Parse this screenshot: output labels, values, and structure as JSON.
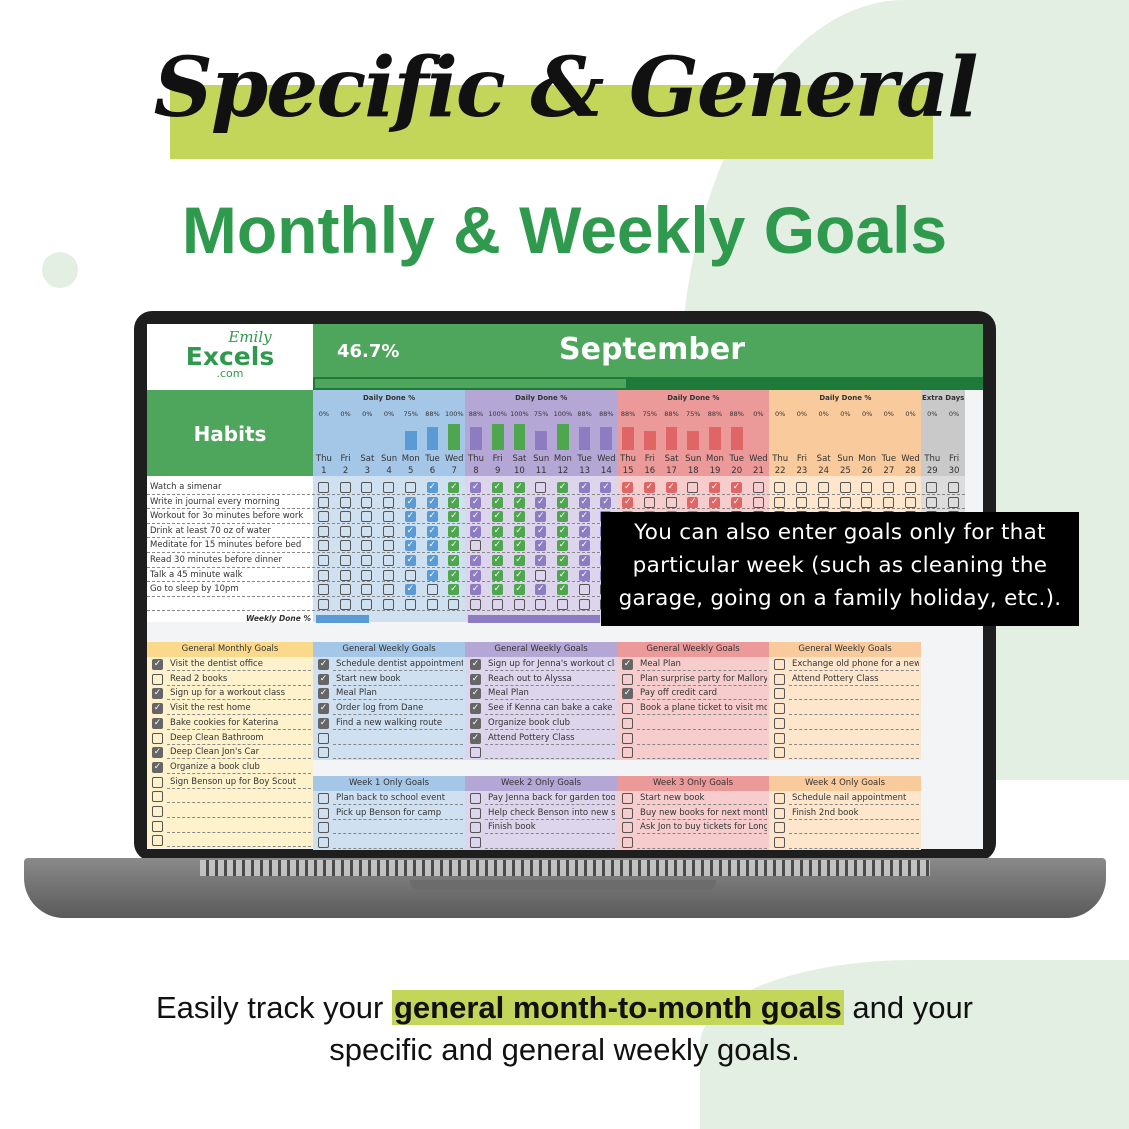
{
  "title_script": "Specific & General",
  "title_main": "Monthly & Weekly Goals",
  "colors": {
    "accent_green": "#2f9a4e",
    "lime": "#c3d65a",
    "week1": "#5b9bd5",
    "week2": "#8e7cc3",
    "week3": "#e06666",
    "week4": "#f9cb9c",
    "extra": "#bdbdbd",
    "done_full": "#4ea64f"
  },
  "logo": {
    "line1": "Emily",
    "line2": "Excels",
    "line3": ".com"
  },
  "sheet": {
    "month_percent": "46.7%",
    "month_progress": 0.467,
    "month": "September",
    "habits_label": "Habits",
    "weekly_done_label": "Weekly Done %",
    "week_headers": [
      "Daily Done %",
      "Daily Done %",
      "Daily Done %",
      "Daily Done %",
      "Extra Days"
    ],
    "weekly_done": [
      0.36,
      0.9,
      0,
      0,
      0
    ],
    "days": [
      {
        "d": "Thu",
        "n": "1",
        "p": "0%"
      },
      {
        "d": "Fri",
        "n": "2",
        "p": "0%"
      },
      {
        "d": "Sat",
        "n": "3",
        "p": "0%"
      },
      {
        "d": "Sun",
        "n": "4",
        "p": "0%"
      },
      {
        "d": "Mon",
        "n": "5",
        "p": "75%"
      },
      {
        "d": "Tue",
        "n": "6",
        "p": "88%"
      },
      {
        "d": "Wed",
        "n": "7",
        "p": "100%"
      },
      {
        "d": "Thu",
        "n": "8",
        "p": "88%"
      },
      {
        "d": "Fri",
        "n": "9",
        "p": "100%"
      },
      {
        "d": "Sat",
        "n": "10",
        "p": "100%"
      },
      {
        "d": "Sun",
        "n": "11",
        "p": "75%"
      },
      {
        "d": "Mon",
        "n": "12",
        "p": "100%"
      },
      {
        "d": "Tue",
        "n": "13",
        "p": "88%"
      },
      {
        "d": "Wed",
        "n": "14",
        "p": "88%"
      },
      {
        "d": "Thu",
        "n": "15",
        "p": "88%"
      },
      {
        "d": "Fri",
        "n": "16",
        "p": "75%"
      },
      {
        "d": "Sat",
        "n": "17",
        "p": "88%"
      },
      {
        "d": "Sun",
        "n": "18",
        "p": "75%"
      },
      {
        "d": "Mon",
        "n": "19",
        "p": "88%"
      },
      {
        "d": "Tue",
        "n": "20",
        "p": "88%"
      },
      {
        "d": "Wed",
        "n": "21",
        "p": "0%"
      },
      {
        "d": "Thu",
        "n": "22",
        "p": "0%"
      },
      {
        "d": "Fri",
        "n": "23",
        "p": "0%"
      },
      {
        "d": "Sat",
        "n": "24",
        "p": "0%"
      },
      {
        "d": "Sun",
        "n": "25",
        "p": "0%"
      },
      {
        "d": "Mon",
        "n": "26",
        "p": "0%"
      },
      {
        "d": "Tue",
        "n": "27",
        "p": "0%"
      },
      {
        "d": "Wed",
        "n": "28",
        "p": "0%"
      },
      {
        "d": "Thu",
        "n": "29",
        "p": "0%"
      },
      {
        "d": "Fri",
        "n": "30",
        "p": "0%"
      }
    ],
    "habits": [
      {
        "name": "Watch a simenar",
        "checks": "000001111101111110110000000000"
      },
      {
        "name": "Write in journal every morning",
        "checks": "000011111111111001110000000000"
      },
      {
        "name": "Workout for 3o minutes before work",
        "checks": "000011111111111111100000000000"
      },
      {
        "name": "Drink at least 70 oz of water",
        "checks": "000011111111111111110000000000"
      },
      {
        "name": "Meditate for 15 minutes before bed",
        "checks": "000011101111111111010000000000"
      },
      {
        "name": "Read 30 minutes before dinner",
        "checks": "000011111111111111110000000000"
      },
      {
        "name": "Talk a 45 minute walk",
        "checks": "000001111101111011110000000000"
      },
      {
        "name": "Go to sleep by 10pm",
        "checks": "000010111111000110110000000000"
      },
      {
        "name": "",
        "checks": "000000000000000000000000000000"
      }
    ],
    "monthly_goals": {
      "title": "General Monthly Goals",
      "items": [
        {
          "text": "Visit the dentist office",
          "done": true
        },
        {
          "text": "Read 2 books",
          "done": false
        },
        {
          "text": "Sign up for a workout class",
          "done": true
        },
        {
          "text": "Visit the rest home",
          "done": true
        },
        {
          "text": "Bake cookies for Katerina",
          "done": true
        },
        {
          "text": "Deep Clean Bathroom",
          "done": false
        },
        {
          "text": "Deep Clean Jon's Car",
          "done": true
        },
        {
          "text": "Organize a book club",
          "done": true
        },
        {
          "text": "Sign Benson up for Boy Scout",
          "done": false
        },
        {
          "text": "",
          "done": false
        },
        {
          "text": "",
          "done": false
        },
        {
          "text": "",
          "done": false
        },
        {
          "text": "",
          "done": false
        }
      ]
    },
    "weekly_goals": [
      {
        "title": "General Weekly Goals",
        "items": [
          {
            "text": "Schedule dentist appointment",
            "done": true
          },
          {
            "text": "Start new book",
            "done": true
          },
          {
            "text": "Meal Plan",
            "done": true
          },
          {
            "text": "Order log from Dane",
            "done": true
          },
          {
            "text": "Find a new walking route",
            "done": true
          },
          {
            "text": "",
            "done": false
          },
          {
            "text": "",
            "done": false
          }
        ],
        "only_title": "Week 1 Only Goals",
        "only": [
          {
            "text": "Plan back to school event",
            "done": false
          },
          {
            "text": "Pick up Benson for camp",
            "done": false
          },
          {
            "text": "",
            "done": false
          },
          {
            "text": "",
            "done": false
          }
        ]
      },
      {
        "title": "General Weekly Goals",
        "items": [
          {
            "text": "Sign up for Jenna's workout class",
            "done": true
          },
          {
            "text": "Reach out to Alyssa",
            "done": true
          },
          {
            "text": "Meal Plan",
            "done": true
          },
          {
            "text": "See if Kenna can bake a cake for",
            "done": true
          },
          {
            "text": "Organize book club",
            "done": true
          },
          {
            "text": "Attend Pottery Class",
            "done": true
          },
          {
            "text": "",
            "done": false
          }
        ],
        "only_title": "Week 2 Only Goals",
        "only": [
          {
            "text": "Pay Jenna back for garden tools",
            "done": false
          },
          {
            "text": "Help check Benson into new school",
            "done": false
          },
          {
            "text": "Finish book",
            "done": false
          },
          {
            "text": "",
            "done": false
          }
        ]
      },
      {
        "title": "General Weekly Goals",
        "items": [
          {
            "text": "Meal Plan",
            "done": true
          },
          {
            "text": "Plan surprise party for Mallory",
            "done": false
          },
          {
            "text": "Pay off credit card",
            "done": true
          },
          {
            "text": "Book a plane ticket to visit mom",
            "done": false
          },
          {
            "text": "",
            "done": false
          },
          {
            "text": "",
            "done": false
          },
          {
            "text": "",
            "done": false
          }
        ],
        "only_title": "Week 3 Only Goals",
        "only": [
          {
            "text": "Start new book",
            "done": false
          },
          {
            "text": "Buy new books for next month",
            "done": false
          },
          {
            "text": "Ask Jon to buy tickets for Long",
            "done": false
          },
          {
            "text": "",
            "done": false
          }
        ]
      },
      {
        "title": "General Weekly Goals",
        "items": [
          {
            "text": "Exchange old phone for a new",
            "done": false
          },
          {
            "text": "Attend Pottery Class",
            "done": false
          },
          {
            "text": "",
            "done": false
          },
          {
            "text": "",
            "done": false
          },
          {
            "text": "",
            "done": false
          },
          {
            "text": "",
            "done": false
          },
          {
            "text": "",
            "done": false
          }
        ],
        "only_title": "Week 4 Only Goals",
        "only": [
          {
            "text": "Schedule nail appointment",
            "done": false
          },
          {
            "text": "Finish 2nd book",
            "done": false
          },
          {
            "text": "",
            "done": false
          },
          {
            "text": "",
            "done": false
          }
        ]
      }
    ]
  },
  "callout": [
    "You can also enter goals only for that",
    "particular week (such as cleaning the",
    "garage, going on a family holiday, etc.)."
  ],
  "bottom": {
    "pre": "Easily track your ",
    "highlight": "general month-to-month goals",
    "post": " and your",
    "line2": "specific and general weekly goals."
  }
}
